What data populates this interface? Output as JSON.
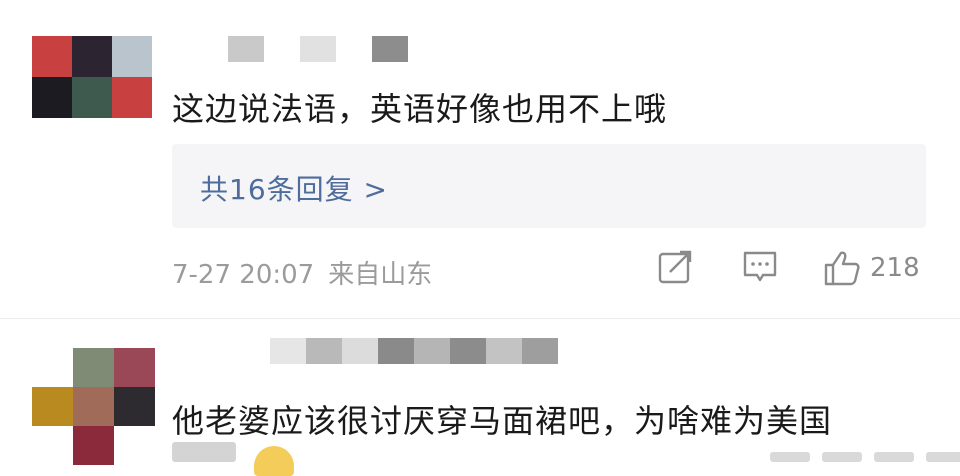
{
  "comments": [
    {
      "text": "这边说法语，英语好像也用不上哦",
      "replies_label": "共16条回复 >",
      "timestamp": "7-27 20:07",
      "location": "来自山东",
      "likes": "218",
      "icons": {
        "share": "share-edit-icon",
        "reply": "comment-bubble-icon",
        "like": "thumbs-up-icon"
      }
    },
    {
      "text": "他老婆应该很讨厌穿马面裙吧，为啥难为美国"
    }
  ],
  "colors": {
    "link": "#4e6d9c",
    "meta": "#9b9b9b",
    "reply_bg": "#f5f5f7"
  }
}
